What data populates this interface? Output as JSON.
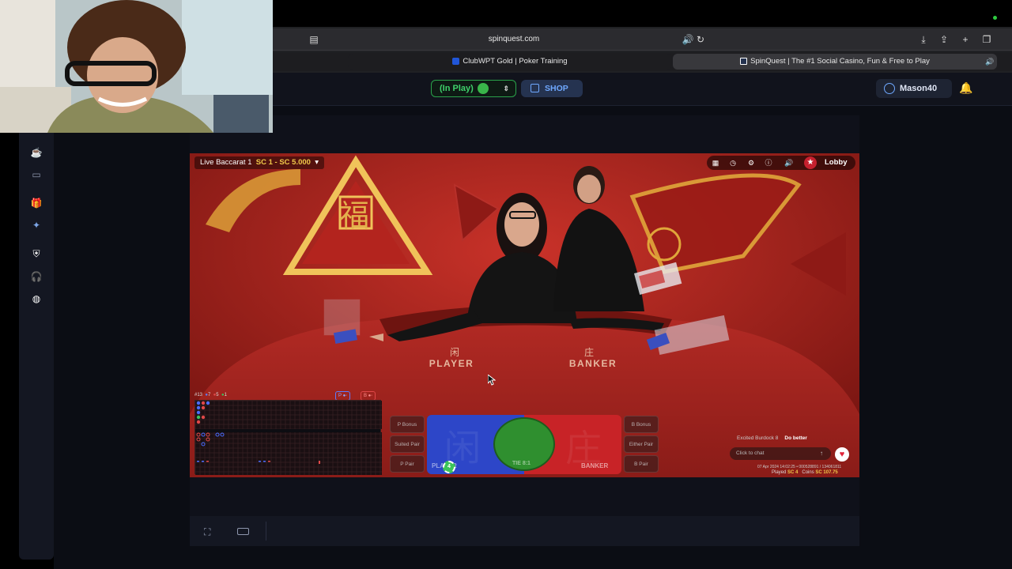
{
  "browser": {
    "url": "spinquest.com",
    "tabs": [
      {
        "label": "ClubWPT Gold | Poker Training",
        "active": false
      },
      {
        "label": "SpinQuest | The #1 Social Casino, Fun & Free to Play",
        "active": true
      }
    ]
  },
  "header": {
    "play_mode": "(In Play)",
    "shop_label": "SHOP",
    "username": "Mason40"
  },
  "sidebar": {
    "icons": [
      "cup-icon",
      "tv-icon",
      "cash-icon",
      "gift-icon",
      "discord-icon",
      "shield-icon",
      "headset-icon",
      "globe-icon"
    ]
  },
  "game": {
    "table_name": "Live Baccarat 1",
    "limits": "SC 1 - SC 5.000",
    "lobby_label": "Lobby",
    "felt_player": "PLAYER",
    "felt_banker": "BANKER",
    "felt_player_char": "闲",
    "felt_banker_char": "庄",
    "banner_char": "福",
    "road_stats": {
      "round": "#13",
      "player": "7",
      "banker": "5",
      "tie": "1",
      "p_label": "P",
      "b_label": "B"
    },
    "side_bets_left": [
      "P Bonus",
      "Suited Pair",
      "P Pair"
    ],
    "side_bets_right": [
      "B Bonus",
      "Either Pair",
      "B Pair"
    ],
    "bet_player_label": "PLAYER",
    "bet_banker_label": "BANKER",
    "bet_tie_label": "TIE 8:1",
    "chip_value": "4",
    "chat": {
      "user": "Excited Burdock 8",
      "message": "Do better",
      "placeholder": "Click to chat"
    },
    "timestamp": "07 Apr 2024 14:02:25 • 000528891 / 134061811",
    "played_label": "Played",
    "played_value": "SC 4",
    "coins_label": "Coins",
    "coins_value": "SC 107.75"
  },
  "colors": {
    "player_blue": "#2d46c8",
    "banker_red": "#c82327",
    "tie_green": "#2f8f2f",
    "accent_gold": "#f0c94a",
    "brand_blue": "#6fa8ff"
  }
}
